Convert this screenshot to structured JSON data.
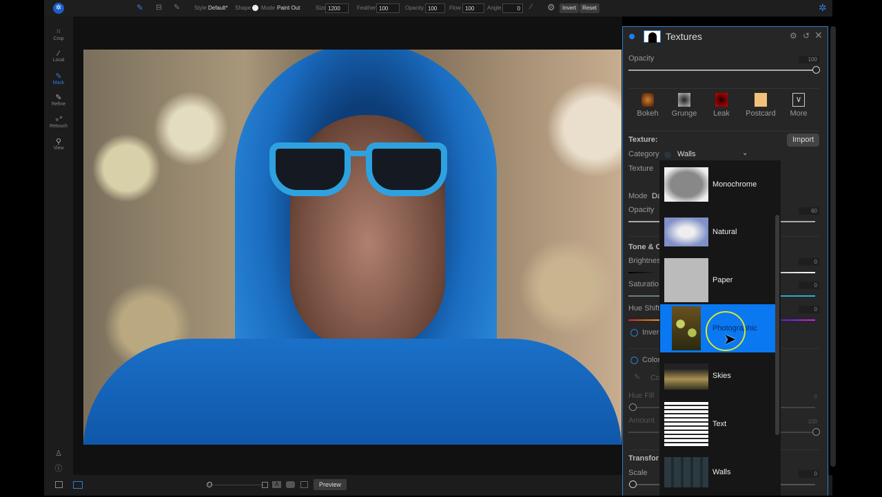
{
  "top_toolbar": {
    "style_label": "Style",
    "style_value": "Default*",
    "shape_label": "Shape",
    "mode_label": "Mode",
    "mode_value": "Paint Out",
    "size_label": "Size",
    "size_value": "1200",
    "feather_label": "Feather",
    "feather_value": "100",
    "opacity_label": "Opacity",
    "opacity_value": "100",
    "flow_label": "Flow",
    "flow_value": "100",
    "angle_label": "Angle",
    "angle_value": "0",
    "invert_label": "Invert",
    "reset_label": "Reset"
  },
  "left_tools": [
    {
      "label": "Crop",
      "icon": "crop-icon"
    },
    {
      "label": "Local",
      "icon": "local-brush-icon"
    },
    {
      "label": "Mask",
      "icon": "mask-brush-icon",
      "active": true
    },
    {
      "label": "Refine",
      "icon": "refine-brush-icon"
    },
    {
      "label": "Retouch",
      "icon": "retouch-icon"
    },
    {
      "label": "View",
      "icon": "view-zoom-icon"
    }
  ],
  "bottom_bar": {
    "preview_label": "Preview"
  },
  "panel": {
    "title": "Textures",
    "opacity_label": "Opacity",
    "opacity_value": "100",
    "presets": [
      {
        "label": "Bokeh",
        "color": "#8a3a10"
      },
      {
        "label": "Grunge",
        "color": "#666666"
      },
      {
        "label": "Leak",
        "color": "#900000"
      },
      {
        "label": "Postcard",
        "color": "#f0c080"
      },
      {
        "label": "More"
      }
    ],
    "texture_heading": "Texture:",
    "import_label": "Import",
    "category_label": "Category",
    "category_value": "Walls",
    "texture_label": "Texture",
    "mode_label": "Mode",
    "mode_value": "Da",
    "opacity2_label": "Opacity",
    "opacity2_value": "60",
    "tone_heading": "Tone & C",
    "brightness_label": "Brightnes",
    "brightness_value": "0",
    "saturation_label": "Saturatio",
    "saturation_value": "0",
    "hue_shift_label": "Hue Shift",
    "hue_shift_value": "0",
    "invert_label": "Inver",
    "color_label": "Color",
    "color_pick_label": "Co",
    "hue_fill_label": "Hue Fill",
    "hue_fill_value": "0",
    "amount_label": "Amount",
    "amount_value": "100",
    "transform_heading": "Transfor",
    "scale_label": "Scale",
    "scale_value": "0"
  },
  "dropdown": {
    "items": [
      "Monochrome",
      "Natural",
      "Paper",
      "Photographic",
      "Skies",
      "Text",
      "Walls"
    ],
    "selected": "Photographic"
  },
  "colors": {
    "accent": "#0a78f0",
    "panel_bg": "#262626"
  }
}
